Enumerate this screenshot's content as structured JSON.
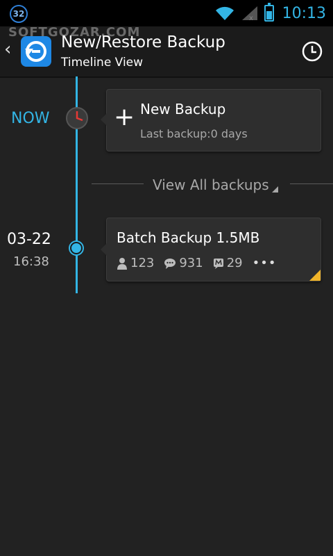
{
  "status_bar": {
    "notification_count": "32",
    "time": "10:13",
    "icons": [
      "wifi-icon",
      "signal-icon",
      "battery-icon"
    ],
    "battery_level_percent": 60,
    "accent_color": "#33b5e5"
  },
  "action_bar": {
    "title": "New/Restore Backup",
    "subtitle": "Timeline View",
    "watermark": "SOFTGOZAR.COM",
    "back_icon": "chevron-left-icon",
    "app_icon": "backup-restore-icon",
    "history_icon": "clock-icon"
  },
  "timeline": {
    "now_label": "NOW",
    "new_backup": {
      "title": "New Backup",
      "subtitle": "Last backup:0 days"
    },
    "view_all_label": "View All backups",
    "entries": [
      {
        "date": "03-22",
        "time": "16:38",
        "title": "Batch Backup 1.5MB",
        "contacts": "123",
        "messages": "931",
        "call_logs": "29",
        "more": "•••"
      }
    ]
  }
}
